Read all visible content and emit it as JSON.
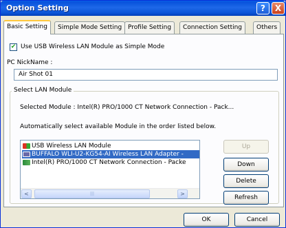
{
  "window": {
    "title": "Option Setting"
  },
  "titlebar_buttons": {
    "help": "?",
    "close": "X"
  },
  "tabs": [
    {
      "label": "Basic Setting"
    },
    {
      "label": "Simple Mode Setting"
    },
    {
      "label": "Profile Setting"
    },
    {
      "label": "Connection Setting"
    },
    {
      "label": "Others"
    }
  ],
  "basic": {
    "simple_mode_checkbox": {
      "label": "Use USB Wireless LAN Module as Simple Mode",
      "mark": "✔"
    },
    "nickname": {
      "label": "PC NickName :",
      "value": "Air Shot 01"
    },
    "lan_group": {
      "title": "Select LAN Module",
      "selected_module": "Selected Module : Intel(R) PRO/1000 CT Network Connection - Pack...",
      "auto_text": "Automatically select available Module in the order listed below.",
      "modules": [
        {
          "label": "USB Wireless LAN Module",
          "icon": "usb-wlan-icon"
        },
        {
          "label": "BUFFALO WLI-U2-KG54-AI Wireless LAN Adapter -",
          "icon": "wlan-adapter-icon"
        },
        {
          "label": "Intel(R) PRO/1000 CT Network Connection - Packe",
          "icon": "network-card-icon"
        }
      ],
      "buttons": {
        "up": "Up",
        "down": "Down",
        "delete": "Delete",
        "refresh": "Refresh"
      },
      "scroll": {
        "left": "<",
        "right": ">",
        "thumb": "|||"
      }
    }
  },
  "footer": {
    "ok": "OK",
    "cancel": "Cancel"
  }
}
